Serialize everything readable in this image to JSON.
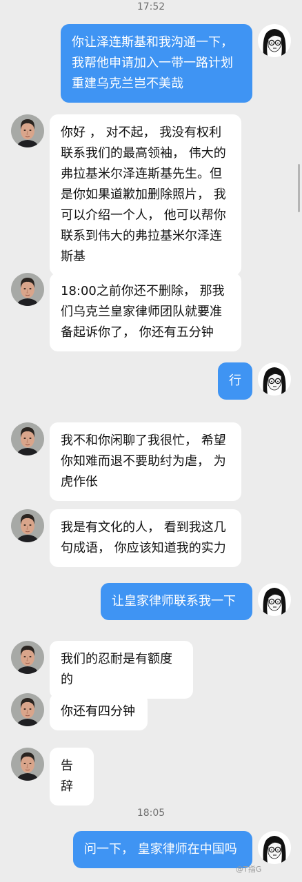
{
  "timestamps": [
    "17:52",
    "18:05"
  ],
  "messages": [
    {
      "from": "me",
      "text": "你让泽连斯基和我沟通一下，\n我帮他申请加入一带一路计划\n重建乌克兰岂不美哉"
    },
    {
      "from": "them",
      "text": "你好 ， 对不起， 我没有权利\n联系我们的最高领袖， 伟大的\n弗拉基米尔泽连斯基先生。但\n是你如果道歉加删除照片， 我\n可以介绍一个人， 他可以帮你\n联系到伟大的弗拉基米尔泽连\n斯基"
    },
    {
      "from": "them",
      "text": "18:00之前你还不删除， 那我\n们乌克兰皇家律师团队就要准\n备起诉你了， 你还有五分钟"
    },
    {
      "from": "me",
      "text": "行"
    },
    {
      "from": "them",
      "text": "我不和你闲聊了我很忙， 希望\n你知难而退不要助纣为虐， 为\n虎作伥"
    },
    {
      "from": "them",
      "text": "我是有文化的人， 看到我这几\n句成语， 你应该知道我的实力"
    },
    {
      "from": "me",
      "text": "让皇家律师联系我一下"
    },
    {
      "from": "them",
      "text": "我们的忍耐是有额度的"
    },
    {
      "from": "them",
      "text": "你还有四分钟"
    },
    {
      "from": "them",
      "text": "告辞"
    },
    {
      "from": "me",
      "text": "问一下， 皇家律师在中国吗"
    }
  ],
  "watermark": "@T指G",
  "colors": {
    "outgoing_bubble": "#3f94f3",
    "incoming_bubble": "#ffffff",
    "background": "#ececec"
  },
  "icons": {
    "incoming_avatar": "man-face-avatar",
    "outgoing_avatar": "cartoon-woman-glasses-avatar"
  }
}
